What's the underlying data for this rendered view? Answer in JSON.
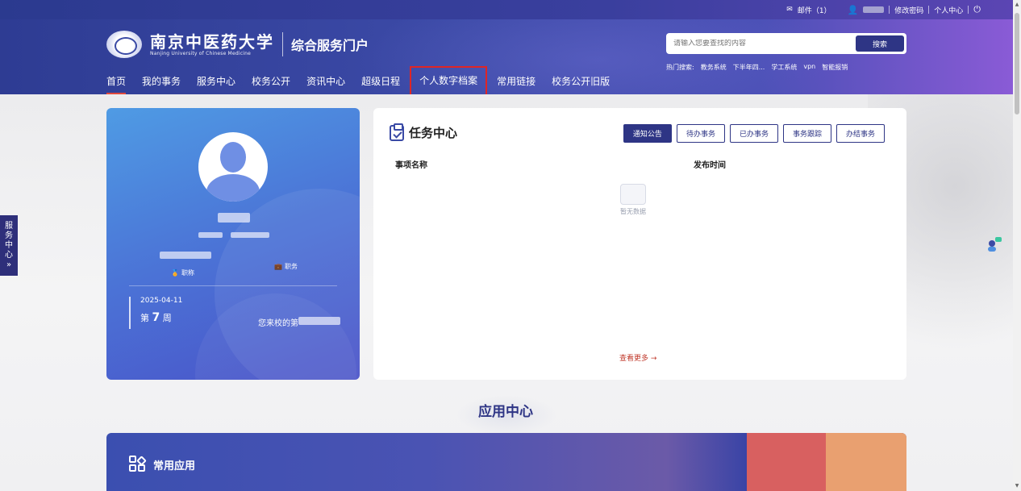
{
  "utilbar": {
    "mail_label": "邮件（1）",
    "change_password": "修改密码",
    "personal_center": "个人中心"
  },
  "header": {
    "logo_cn": "南京中医药大学",
    "logo_en": "Nanjing University of Chinese Medicine",
    "portal_name": "综合服务门户",
    "search_placeholder": "请输入您要查找的内容",
    "search_button": "搜索",
    "hot_search": {
      "label": "热门搜索:",
      "items": [
        "教务系统",
        "下半年四...",
        "学工系统",
        "vpn",
        "智能报销"
      ]
    },
    "nav": [
      "首页",
      "我的事务",
      "服务中心",
      "校务公开",
      "资讯中心",
      "超级日程",
      "个人数字档案",
      "常用链接",
      "校务公开旧版"
    ]
  },
  "profile": {
    "title_label": "职称",
    "position_label": "职务",
    "date": "2025-04-11",
    "week_prefix": "第",
    "week_number": "7",
    "week_suffix": "周",
    "since_label": "您来校的第"
  },
  "task_center": {
    "title": "任务中心",
    "tabs": [
      "通知公告",
      "待办事务",
      "已办事务",
      "事务跟踪",
      "办结事务"
    ],
    "col_name": "事项名称",
    "col_time": "发布时间",
    "empty_text": "暂无数据",
    "more_text": "查看更多 →"
  },
  "app_center": {
    "title": "应用中心",
    "common_apps": "常用应用"
  },
  "sidetab": {
    "chars": [
      "服",
      "务",
      "中",
      "心",
      "»"
    ]
  },
  "colors": {
    "brand": "#2e3585",
    "highlight_box": "#e02525",
    "nav_active": "#e0483c"
  }
}
